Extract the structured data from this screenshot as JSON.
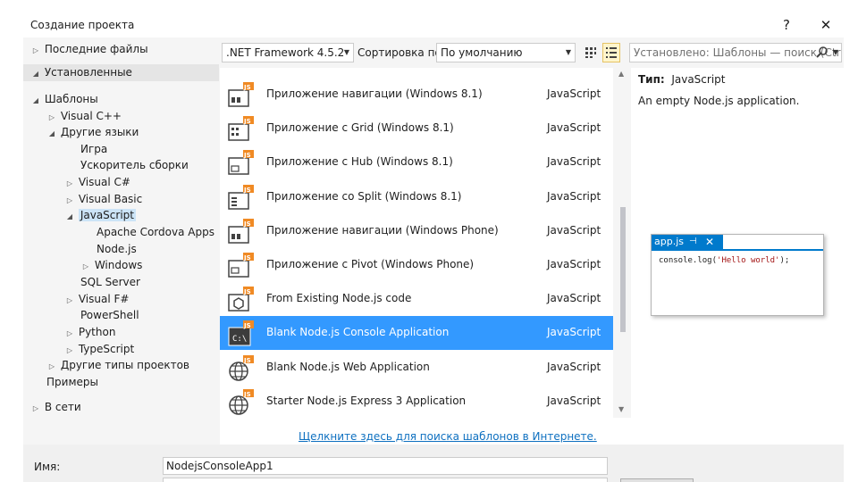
{
  "window": {
    "title": "Создание проекта",
    "help": "?",
    "close": "✕"
  },
  "tree": {
    "recent": "Последние файлы",
    "installed": "Установленные",
    "templates": "Шаблоны",
    "visual_cpp": "Visual C++",
    "other_languages": "Другие языки",
    "game": "Игра",
    "build_accelerator": "Ускоритель сборки",
    "visual_csharp": "Visual C#",
    "visual_basic": "Visual Basic",
    "javascript": "JavaScript",
    "apache_cordova": "Apache Cordova Apps",
    "nodejs": "Node.js",
    "windows": "Windows",
    "sql_server": "SQL Server",
    "visual_fsharp": "Visual F#",
    "powershell": "PowerShell",
    "python": "Python",
    "typescript": "TypeScript",
    "other_project_types": "Другие типы проектов",
    "samples": "Примеры",
    "online": "В сети"
  },
  "toolbar": {
    "framework": ".NET Framework 4.5.2",
    "sort_label": "Сортировка по:",
    "sort_value": "По умолчанию",
    "search_placeholder": "Установлено: Шаблоны — поиск (Ctr"
  },
  "templates": [
    {
      "name": "Приложение навигации (Windows 8.1)",
      "lang": "JavaScript",
      "icon": "navigation-app-icon"
    },
    {
      "name": "Приложение с Grid (Windows 8.1)",
      "lang": "JavaScript",
      "icon": "grid-app-icon"
    },
    {
      "name": "Приложение с Hub (Windows 8.1)",
      "lang": "JavaScript",
      "icon": "hub-app-icon"
    },
    {
      "name": "Приложение со Split (Windows 8.1)",
      "lang": "JavaScript",
      "icon": "split-app-icon"
    },
    {
      "name": "Приложение навигации (Windows Phone)",
      "lang": "JavaScript",
      "icon": "navigation-app-icon"
    },
    {
      "name": "Приложение с Pivot (Windows Phone)",
      "lang": "JavaScript",
      "icon": "pivot-app-icon"
    },
    {
      "name": "From Existing Node.js code",
      "lang": "JavaScript",
      "icon": "nodejs-hexagon-icon"
    },
    {
      "name": "Blank Node.js Console Application",
      "lang": "JavaScript",
      "icon": "console-icon"
    },
    {
      "name": "Blank Node.js Web Application",
      "lang": "JavaScript",
      "icon": "globe-icon"
    },
    {
      "name": "Starter Node.js Express 3 Application",
      "lang": "JavaScript",
      "icon": "globe-icon"
    }
  ],
  "selected_template_index": 7,
  "online_link": "Щелкните здесь для поиска шаблонов в Интернете.",
  "info": {
    "type_label": "Тип:",
    "type_value": "JavaScript",
    "description": "An empty Node.js application."
  },
  "preview": {
    "tab_name": "app.js",
    "pin_glyph": "⊣",
    "close_glyph": "✕",
    "code_prefix": "console.log(",
    "code_string": "'Hello world'",
    "code_suffix": ");"
  },
  "bottom": {
    "name_label": "Имя:",
    "name_value": "NodejsConsoleApp1"
  },
  "colors": {
    "selection": "#3399ff",
    "accent": "#007acc",
    "link": "#0e70c0",
    "js_badge": "#f08a24"
  }
}
